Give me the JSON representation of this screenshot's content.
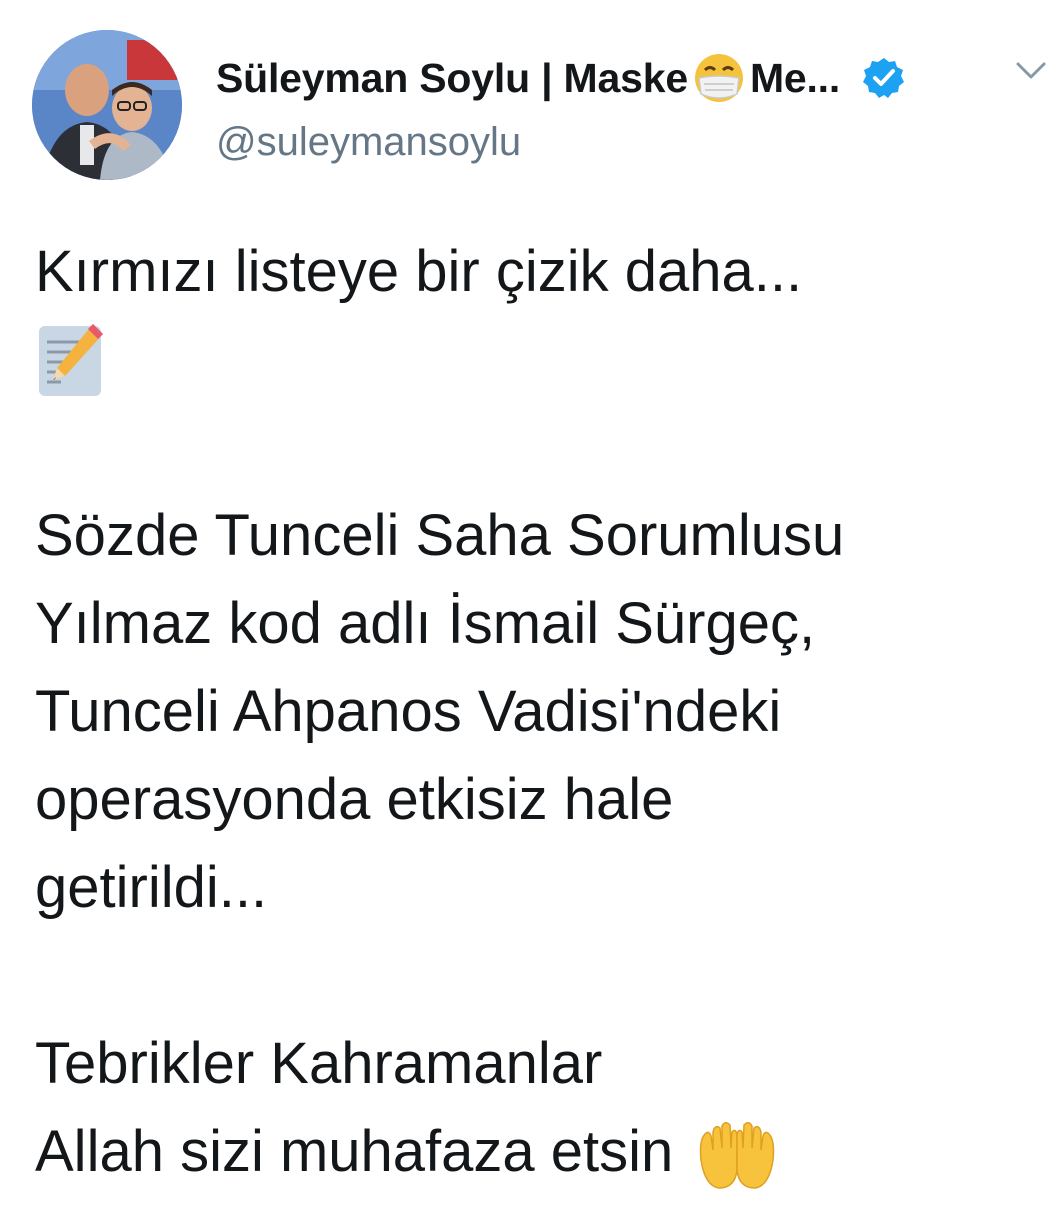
{
  "author": {
    "display_name_prefix": "Süleyman Soylu | Maske",
    "display_name_suffix": "Me...",
    "handle": "@suleymansoylu",
    "verified": true
  },
  "icons": {
    "verified": "verified-badge-icon",
    "menu": "chevron-down-icon",
    "name_emoji": "face-with-medical-mask-emoji",
    "memo_emoji": "memo-emoji",
    "hands_emoji": "palms-up-together-emoji"
  },
  "colors": {
    "verified": "#1da1f2",
    "text": "#14171a",
    "secondary": "#657786"
  },
  "tweet": {
    "line1": "Kırmızı listeye bir çizik daha...",
    "line3": "Sözde Tunceli Saha Sorumlusu",
    "line4": "Yılmaz kod adlı İsmail Sürgeç,",
    "line5": "Tunceli Ahpanos Vadisi'ndeki",
    "line6": "operasyonda etkisiz hale",
    "line7": "getirildi...",
    "line9": "Tebrikler Kahramanlar",
    "line10": "Allah sizi muhafaza etsin"
  }
}
